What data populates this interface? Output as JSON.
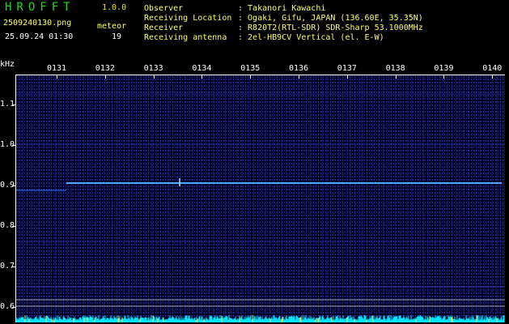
{
  "header": {
    "app_name": "HROFFT",
    "version": "1.0.0",
    "filename": "2509240130.png",
    "datetime": "25.09.24 01:30",
    "meteor_label": "meteor",
    "meteor_count": "19"
  },
  "info": {
    "observer_label": "Observer",
    "observer_value": ": Takanori Kawachi",
    "location_label": "Receiving Location",
    "location_value": ": Ogaki, Gifu, JAPAN (136.60E, 35.35N)",
    "receiver_label": "Receiver",
    "receiver_value": ": R820T2(RTL-SDR) SDR-Sharp 53.1000MHz",
    "antenna_label": "Receiving antenna",
    "antenna_value": ": 2el-HB9CV Vertical (el. E-W)"
  },
  "axis": {
    "y_unit": "kHz",
    "y_ticks": [
      "1.1",
      "1.0",
      "0.9",
      "0.8",
      "0.7",
      "0.6"
    ],
    "x_ticks": [
      "0131",
      "0132",
      "0133",
      "0134",
      "0135",
      "0136",
      "0137",
      "0138",
      "0139",
      "0140"
    ]
  },
  "colors": {
    "title": "#1fd81f",
    "labels": "#ffff66",
    "background": "#000000",
    "signal": "#4da6ff",
    "baseline": "#00e5ff"
  }
}
